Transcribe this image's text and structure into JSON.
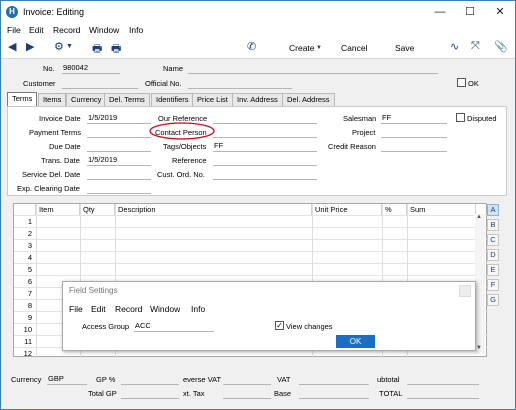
{
  "window": {
    "title": "Invoice: Editing"
  },
  "menubar": [
    "File",
    "Edit",
    "Record",
    "Window",
    "Info"
  ],
  "toolbar": {
    "create": "Create",
    "cancel": "Cancel",
    "save": "Save"
  },
  "header": {
    "no_label": "No.",
    "no_value": "980042",
    "name_label": "Name",
    "name_value": "",
    "customer_label": "Customer",
    "customer_value": "",
    "official_label": "Official No.",
    "official_value": "",
    "ok_label": "OK"
  },
  "tabs": [
    "Terms",
    "Items",
    "Currency",
    "Del. Terms",
    "Identifiers",
    "Price List",
    "Inv. Address",
    "Del. Address"
  ],
  "terms": {
    "invoice_date_label": "Invoice Date",
    "invoice_date": "1/5/2019",
    "payment_terms_label": "Payment Terms",
    "payment_terms": "",
    "due_date_label": "Due Date",
    "due_date": "",
    "trans_date_label": "Trans. Date",
    "trans_date": "1/5/2019",
    "service_del_label": "Service Del. Date",
    "service_del": "",
    "exp_clearing_label": "Exp. Clearing Date",
    "exp_clearing": "",
    "our_ref_label": "Our Reference",
    "our_ref": "",
    "contact_label": "Contact Person",
    "contact": "",
    "objects_label": "Tags/Objects",
    "objects": "FF",
    "reference_label": "Reference",
    "reference": "",
    "cust_ord_label": "Cust. Ord. No.",
    "cust_ord": "",
    "salesman_label": "Salesman",
    "salesman": "FF",
    "project_label": "Project",
    "project": "",
    "credit_reason_label": "Credit Reason",
    "credit_reason": "",
    "disputed_label": "Disputed"
  },
  "grid": {
    "columns": [
      "",
      "Item",
      "Qty",
      "Description",
      "Unit Price",
      "%",
      "Sum"
    ],
    "rows": [
      "1",
      "2",
      "3",
      "4",
      "5",
      "6",
      "7",
      "8",
      "9",
      "10",
      "11",
      "12"
    ],
    "side_letters": [
      "A",
      "B",
      "C",
      "D",
      "E",
      "F",
      "G"
    ]
  },
  "dialog": {
    "title": "Field Settings",
    "menu": [
      "File",
      "Edit",
      "Record",
      "Window",
      "Info"
    ],
    "access_group_label": "Access Group",
    "access_group": "ACC",
    "view_changes_label": "View changes",
    "ok": "OK"
  },
  "footer": {
    "currency_label": "Currency",
    "currency": "GBP",
    "gp_label": "GP %",
    "gp": "",
    "reverse_vat_label": "everse VAT",
    "reverse_vat": "",
    "vat_label": "VAT",
    "vat": "",
    "subtotal_label": "ubtotal",
    "subtotal": "",
    "total_gp_label": "Total GP",
    "total_gp": "",
    "ext_tax_label": "xt. Tax",
    "ext_tax": "",
    "base_label": "Base",
    "base": "",
    "total_label": "TOTAL",
    "total": ""
  },
  "colors": {
    "accent": "#1a6fc4",
    "window_border": "#3c7fb1",
    "highlight_circle": "#d0021b"
  }
}
